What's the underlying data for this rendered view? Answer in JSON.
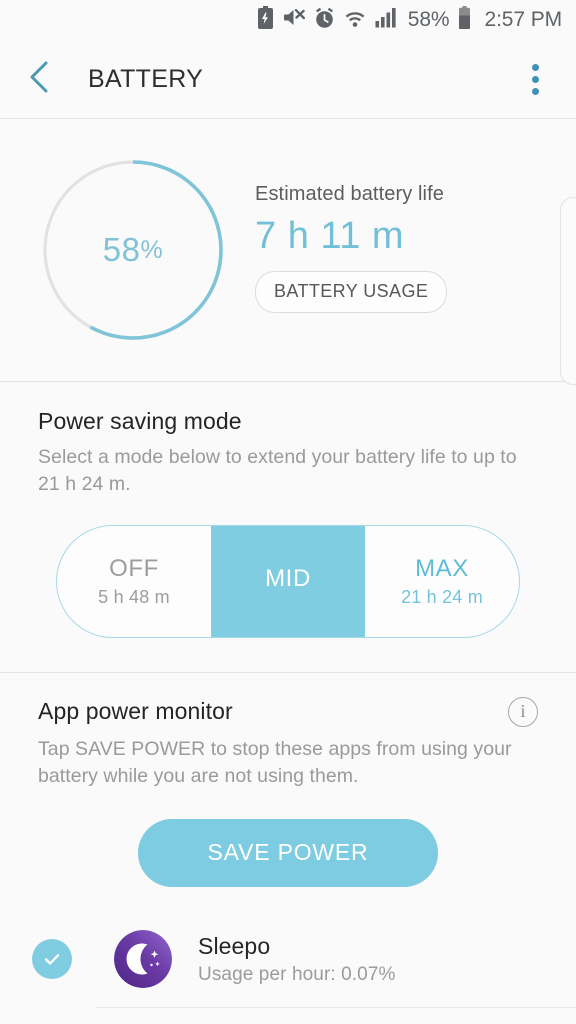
{
  "status_bar": {
    "icons": [
      "battery-saver-icon",
      "mute-icon",
      "alarm-icon",
      "wifi-icon",
      "signal-icon"
    ],
    "battery_percent": "58%",
    "battery_icon": "battery-icon",
    "clock": "2:57 PM"
  },
  "app_bar": {
    "back_icon": "back-chevron-icon",
    "title": "BATTERY",
    "overflow_icon": "overflow-menu-icon"
  },
  "battery_summary": {
    "percent_value": "58",
    "percent_sign": "%",
    "percent_number": 58,
    "estimate_label": "Estimated battery life",
    "estimate_value": "7 h 11 m",
    "usage_button": "BATTERY USAGE"
  },
  "power_saving": {
    "title": "Power saving mode",
    "description": "Select a mode below to extend your battery life to up to 21 h 24 m.",
    "modes": [
      {
        "name": "OFF",
        "subtitle": "5 h 48 m",
        "selected": false
      },
      {
        "name": "MID",
        "subtitle": "",
        "selected": true
      },
      {
        "name": "MAX",
        "subtitle": "21 h 24 m",
        "selected": false
      }
    ]
  },
  "app_power_monitor": {
    "title": "App power monitor",
    "info_icon": "info-icon",
    "info_glyph": "i",
    "description": "Tap SAVE POWER to stop these apps from using your battery while you are not using them.",
    "save_button": "SAVE POWER",
    "apps": [
      {
        "name": "Sleepo",
        "usage": "Usage per hour: 0.07%",
        "checked": true,
        "icon": "moon-app-icon"
      }
    ]
  },
  "colors": {
    "accent": "#7ecce1",
    "accent_dark": "#5fbcd6",
    "ring_track": "#e2e2e2",
    "ring_fill": "#7fc4d8",
    "background": "#fafafa",
    "text_primary": "#262626",
    "text_secondary": "#9a9a9a",
    "app_icon_purple_dark": "#5b2d8e",
    "app_icon_purple_light": "#8a62c8"
  }
}
